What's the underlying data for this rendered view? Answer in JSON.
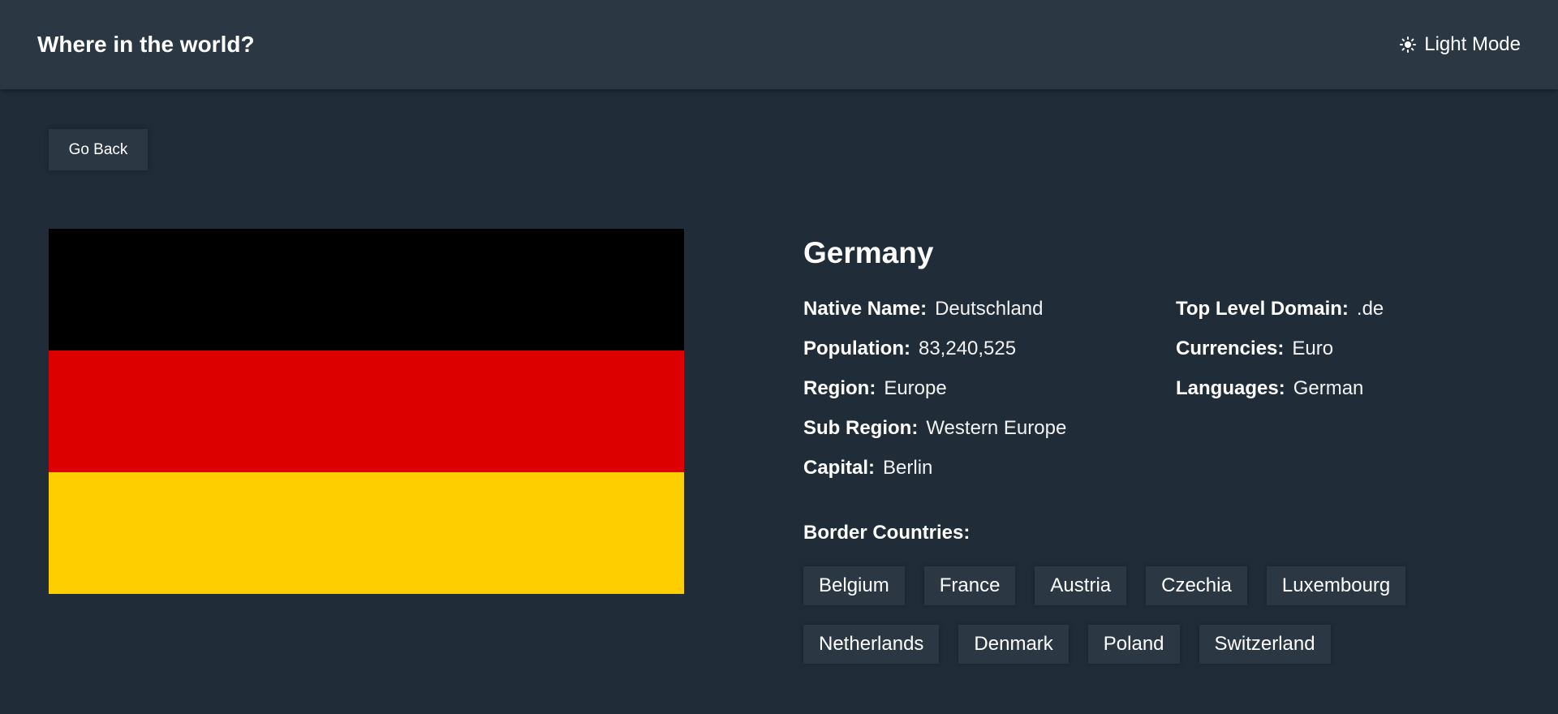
{
  "header": {
    "title": "Where in the world?",
    "mode_icon": "sun-icon",
    "mode_label": "Light Mode"
  },
  "back_button": {
    "label": "Go Back"
  },
  "flag": {
    "colors": [
      "#000000",
      "#dd0000",
      "#ffce00"
    ]
  },
  "country": {
    "name": "Germany",
    "left_fields": [
      {
        "label": "Native Name:",
        "value": "Deutschland"
      },
      {
        "label": "Population:",
        "value": "83,240,525"
      },
      {
        "label": "Region:",
        "value": "Europe"
      },
      {
        "label": "Sub Region:",
        "value": "Western Europe"
      },
      {
        "label": "Capital:",
        "value": "Berlin"
      }
    ],
    "right_fields": [
      {
        "label": "Top Level Domain:",
        "value": ".de"
      },
      {
        "label": "Currencies:",
        "value": "Euro"
      },
      {
        "label": "Languages:",
        "value": "German"
      }
    ],
    "border_title": "Border Countries:",
    "borders": [
      "Belgium",
      "France",
      "Austria",
      "Czechia",
      "Luxembourg",
      "Netherlands",
      "Denmark",
      "Poland",
      "Switzerland"
    ]
  },
  "colors": {
    "background": "#202c37",
    "surface": "#2b3844",
    "text": "#ffffff"
  }
}
